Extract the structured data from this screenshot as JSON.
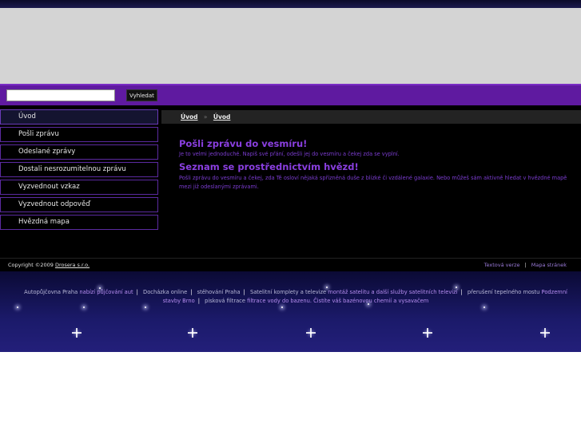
{
  "search": {
    "placeholder": "",
    "button_label": "Vyhledat"
  },
  "menu": {
    "items": [
      {
        "label": "Úvod"
      },
      {
        "label": "Pošli zprávu"
      },
      {
        "label": "Odeslané zprávy"
      },
      {
        "label": "Dostali nesrozumitelnou zprávu"
      },
      {
        "label": "Vyzvednout vzkaz"
      },
      {
        "label": "Vyzvednout odpověď"
      },
      {
        "label": "Hvězdná mapa"
      }
    ]
  },
  "breadcrumb": {
    "items": [
      "Úvod",
      "Úvod"
    ],
    "separator": "»"
  },
  "content": {
    "heading1": "Pošli zprávu do vesmíru!",
    "para1": "Je to velmi jednoduché. Napiš své přání, odešli jej do vesmíru a čekej zda se vyplní.",
    "heading2": "Seznam se prostřednictvím hvězd!",
    "para2": "Pošli zprávu do vesmíru a čekej, zda Tě osloví nějaká spřízněná duše z blízké či vzdálené galaxie. Nebo můžeš sám aktivně hledat v hvězdné mapě mezi již odeslanými zprávami."
  },
  "footer": {
    "copyright_prefix": "Copyright ©2009 ",
    "copyright_link": "Drosera s.r.o.",
    "text_version": "Textová verze",
    "sitemap": "Mapa stránek"
  },
  "ads": {
    "a1": "Autopůjčovna Praha",
    "a2": "nabízí půjčování aut",
    "a3": "Docházka online",
    "a4": "stěhování Praha",
    "a5": "Satelitní komplety a televize",
    "a6": "montáž satelitu a další služby satelitních televizí",
    "a7": "přerušení tepelného mostu",
    "a8": "Podzemní stavby Brno",
    "a9": "pisková filtrace",
    "a10": "filtrace vody do bazenu. Čistíte váš bazénovou chemií a vysavačem"
  },
  "colors": {
    "accent_purple": "#5f1aa0",
    "heading_purple": "#8a3fe0",
    "background": "#000000"
  }
}
